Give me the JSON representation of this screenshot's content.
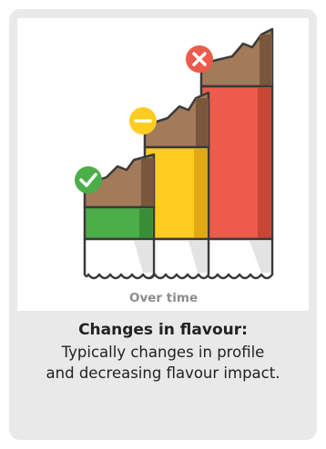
{
  "illustration": {
    "axis_label": "Over time",
    "states": [
      {
        "status": "good",
        "icon": "check-icon",
        "color": "#4cae48"
      },
      {
        "status": "neutral",
        "icon": "minus-icon",
        "color": "#ffcc22"
      },
      {
        "status": "bad",
        "icon": "x-icon",
        "color": "#ed5b4b"
      }
    ],
    "colors": {
      "chocolate": "#a37a5a",
      "chocolate_shadow": "#6e4e36",
      "outline": "#3a3a3a",
      "wrapper": "#ffffff",
      "axis": "#9a9a9a"
    }
  },
  "caption": {
    "title": "Changes in flavour:",
    "line1": "Typically changes in profile",
    "line2": "and decreasing flavour impact."
  }
}
